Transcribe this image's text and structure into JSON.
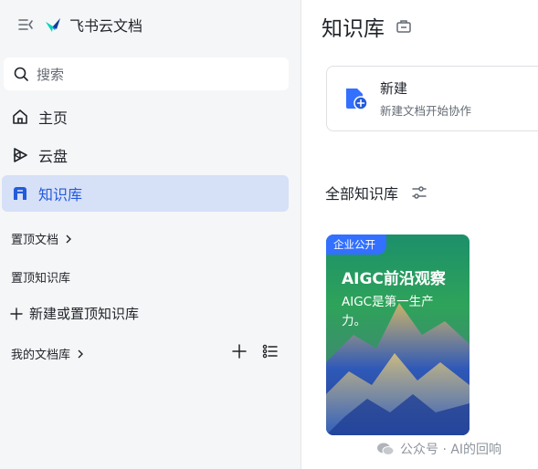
{
  "sidebar": {
    "app_name": "飞书云文档",
    "search_placeholder": "搜索",
    "nav": {
      "home": "主页",
      "drive": "云盘",
      "wiki": "知识库"
    },
    "pinned_docs": "置顶文档",
    "pinned_wiki": "置顶知识库",
    "new_or_pin_wiki": "新建或置顶知识库",
    "my_libraries": "我的文档库"
  },
  "main": {
    "title": "知识库",
    "new_card": {
      "title": "新建",
      "subtitle": "新建文档开始协作"
    },
    "all_wiki": "全部知识库",
    "wiki_card": {
      "badge": "企业公开",
      "title": "AIGC前沿观察",
      "description": "AIGC是第一生产力。"
    }
  },
  "watermark": "公众号 · AI的回响",
  "colors": {
    "accent": "#245bdb",
    "active_bg": "#d6e0f7",
    "badge": "#3370ff"
  }
}
